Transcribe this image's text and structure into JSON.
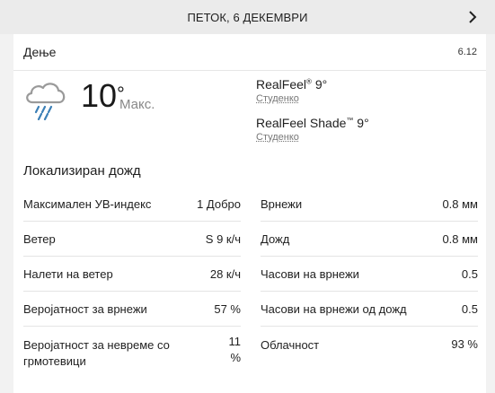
{
  "nav": {
    "date": "ПЕТОК, 6 ДЕКЕМВРИ",
    "next_icon": "chevron-right-icon"
  },
  "period": {
    "label": "Дење",
    "date": "6.12"
  },
  "current": {
    "icon": "rain-cloud-icon",
    "temp": "10",
    "temp_unit": "°",
    "temp_label": "Макс.",
    "realfeel_label": "RealFeel",
    "realfeel_value": "9°",
    "realfeel_desc": "Студенко",
    "realfeel_shade_label": "RealFeel Shade",
    "realfeel_shade_value": "9°",
    "realfeel_shade_desc": "Студенко",
    "phrase": "Локализиран дожд"
  },
  "details_left": [
    {
      "label": "Максимален УВ-индекс",
      "value": "1 Добро"
    },
    {
      "label": "Ветер",
      "value": "S 9 к/ч"
    },
    {
      "label": "Налети на ветер",
      "value": "28 к/ч"
    },
    {
      "label": "Веројатност за врнежи",
      "value": "57 %"
    },
    {
      "label": "Веројатност за невреме со грмотевици",
      "value": "11 %"
    }
  ],
  "details_right": [
    {
      "label": "Врнежи",
      "value": "0.8 мм"
    },
    {
      "label": "Дожд",
      "value": "0.8 мм"
    },
    {
      "label": "Часови на врнежи",
      "value": "0.5"
    },
    {
      "label": "Часови на врнежи од дожд",
      "value": "0.5"
    },
    {
      "label": "Облачност",
      "value": "93 %"
    }
  ],
  "colors": {
    "background": "#f2f2f2",
    "topbar": "#ebebeb",
    "card": "#ffffff",
    "divider": "#e4e4e4",
    "rain_icon": "#3b7fb6",
    "cloud_icon": "#9a9a9a"
  }
}
